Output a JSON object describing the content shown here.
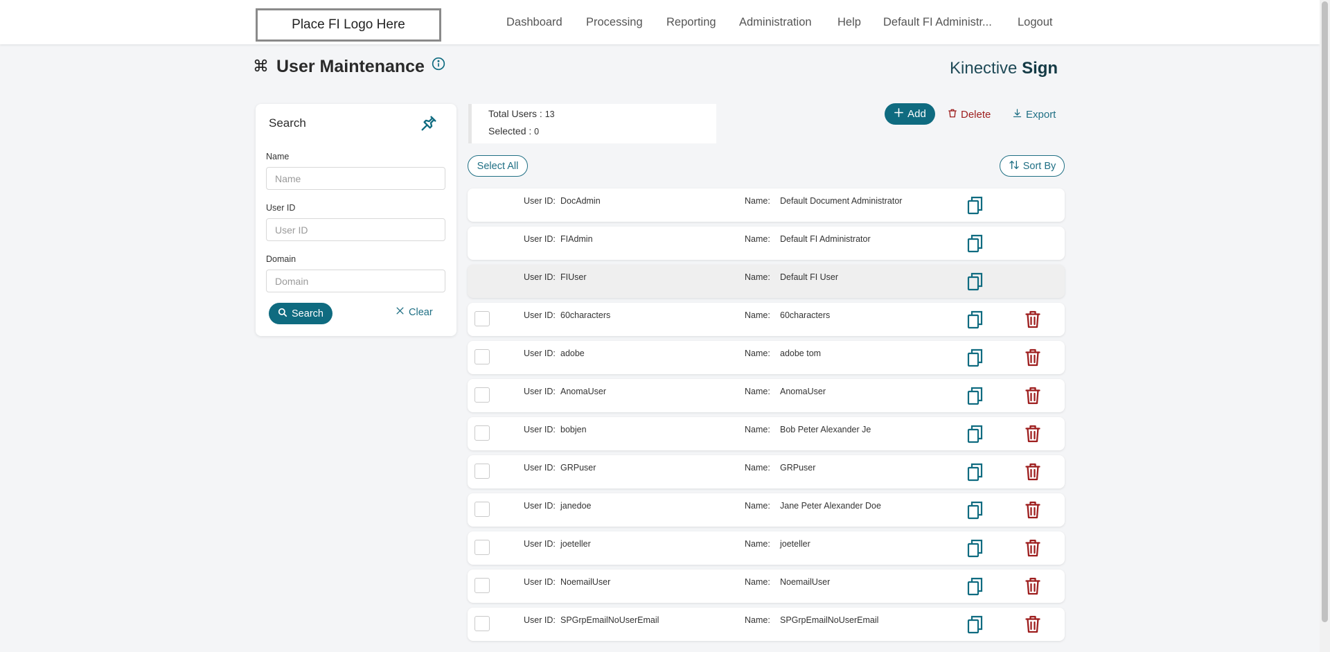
{
  "header": {
    "logo_text": "Place FI Logo Here",
    "nav": [
      "Dashboard",
      "Processing",
      "Reporting",
      "Administration",
      "Help",
      "Default FI Administr...",
      "Logout"
    ]
  },
  "page": {
    "title": "User Maintenance",
    "title_icon": "command-icon",
    "info_icon": "info-icon",
    "brand_light": "Kinective",
    "brand_bold": "Sign"
  },
  "search": {
    "title": "Search",
    "pin_icon": "pin-icon",
    "name_label": "Name",
    "name_placeholder": "Name",
    "userid_label": "User ID",
    "userid_placeholder": "User ID",
    "domain_label": "Domain",
    "domain_placeholder": "Domain",
    "search_button": "Search",
    "clear_button": "Clear"
  },
  "summary": {
    "total_label": "Total Users : ",
    "total_value": "13",
    "selected_label": "Selected : ",
    "selected_value": "0"
  },
  "actions": {
    "add": "Add",
    "delete": "Delete",
    "export": "Export",
    "select_all": "Select All",
    "sort_by": "Sort By"
  },
  "users": {
    "userid_label": "User ID:",
    "name_label": "Name:",
    "rows": [
      {
        "user_id": "DocAdmin",
        "name": "Default Document Administrator",
        "selectable": false,
        "deletable": false,
        "highlighted": false
      },
      {
        "user_id": "FIAdmin",
        "name": "Default FI Administrator",
        "selectable": false,
        "deletable": false,
        "highlighted": false
      },
      {
        "user_id": "FIUser",
        "name": "Default FI User",
        "selectable": false,
        "deletable": false,
        "highlighted": true
      },
      {
        "user_id": "60characters",
        "name": "60characters",
        "selectable": true,
        "deletable": true,
        "highlighted": false
      },
      {
        "user_id": "adobe",
        "name": "adobe tom",
        "selectable": true,
        "deletable": true,
        "highlighted": false
      },
      {
        "user_id": "AnomaUser",
        "name": "AnomaUser",
        "selectable": true,
        "deletable": true,
        "highlighted": false
      },
      {
        "user_id": "bobjen",
        "name": "Bob Peter Alexander Je",
        "selectable": true,
        "deletable": true,
        "highlighted": false
      },
      {
        "user_id": "GRPuser",
        "name": "GRPuser",
        "selectable": true,
        "deletable": true,
        "highlighted": false
      },
      {
        "user_id": "janedoe",
        "name": "Jane Peter Alexander Doe",
        "selectable": true,
        "deletable": true,
        "highlighted": false
      },
      {
        "user_id": "joeteller",
        "name": "joeteller",
        "selectable": true,
        "deletable": true,
        "highlighted": false
      },
      {
        "user_id": "NoemailUser",
        "name": "NoemailUser",
        "selectable": true,
        "deletable": true,
        "highlighted": false
      },
      {
        "user_id": "SPGrpEmailNoUserEmail",
        "name": "SPGrpEmailNoUserEmail",
        "selectable": true,
        "deletable": true,
        "highlighted": false
      }
    ]
  },
  "colors": {
    "primary": "#0f6b80",
    "danger": "#9d1d1d",
    "page_bg": "#f4f5f7"
  }
}
